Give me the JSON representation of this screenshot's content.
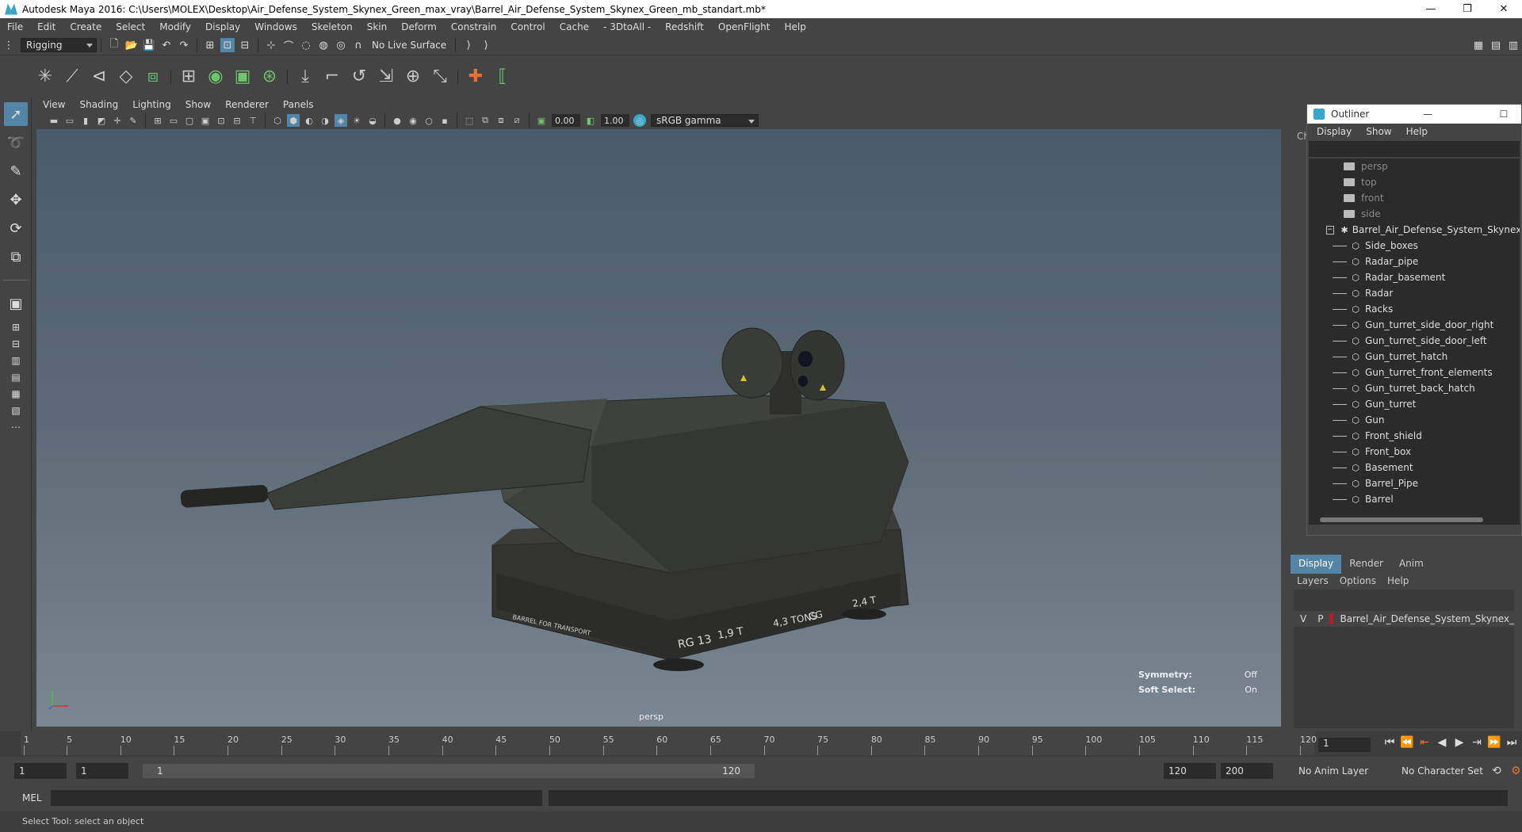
{
  "window": {
    "title": "Autodesk Maya 2016: C:\\Users\\MOLEX\\Desktop\\Air_Defense_System_Skynex_Green_max_vray\\Barrel_Air_Defense_System_Skynex_Green_mb_standart.mb*",
    "min": "—",
    "max": "❐",
    "close": "✕"
  },
  "menu": [
    "File",
    "Edit",
    "Create",
    "Select",
    "Modify",
    "Display",
    "Windows",
    "Skeleton",
    "Skin",
    "Deform",
    "Constrain",
    "Control",
    "Cache",
    "- 3DtoAll -",
    "Redshift",
    "OpenFlight",
    "Help"
  ],
  "status": {
    "mode": "Rigging",
    "live_surface": "No Live Surface"
  },
  "viewport": {
    "menus": [
      "View",
      "Shading",
      "Lighting",
      "Show",
      "Renderer",
      "Panels"
    ],
    "exposure": "0.00",
    "gamma": "1.00",
    "colorspace": "sRGB gamma",
    "camera_label": "persp",
    "hud": {
      "symmetry_label": "Symmetry:",
      "symmetry_value": "Off",
      "softsel_label": "Soft Select:",
      "softsel_value": "On"
    },
    "decals": {
      "rg": "RG 13",
      "weight1": "1,9 T",
      "weight2": "4,3 TONS",
      "cg": "CG",
      "weight3": "2,4 T",
      "transport": "BARREL FOR TRANSPORT"
    }
  },
  "outliner": {
    "title": "Outliner",
    "menus": [
      "Display",
      "Show",
      "Help"
    ],
    "cameras": [
      "persp",
      "top",
      "front",
      "side"
    ],
    "root": "Barrel_Air_Defense_System_Skynex_Green",
    "children": [
      "Side_boxes",
      "Radar_pipe",
      "Radar_basement",
      "Radar",
      "Racks",
      "Gun_turret_side_door_right",
      "Gun_turret_side_door_left",
      "Gun_turret_hatch",
      "Gun_turret_front_elements",
      "Gun_turret_back_hatch",
      "Gun_turret",
      "Gun",
      "Front_shield",
      "Front_box",
      "Basement",
      "Barrel_Pipe",
      "Barrel"
    ]
  },
  "channel_label": "Ch",
  "layers": {
    "tabs": [
      "Display",
      "Render",
      "Anim"
    ],
    "menus": [
      "Layers",
      "Options",
      "Help"
    ],
    "row": {
      "v": "V",
      "p": "P",
      "name": "Barrel_Air_Defense_System_Skynex_"
    }
  },
  "timeline": {
    "ticks": [
      "1",
      "5",
      "10",
      "15",
      "20",
      "25",
      "30",
      "35",
      "40",
      "45",
      "50",
      "55",
      "60",
      "65",
      "70",
      "75",
      "80",
      "85",
      "90",
      "95",
      "100",
      "105",
      "110",
      "115",
      "120"
    ],
    "current_frame": "1"
  },
  "range": {
    "start": "1",
    "playstart": "1",
    "slider_left": "1",
    "slider_right": "120",
    "playend": "120",
    "end": "200",
    "anim_layer": "No Anim Layer",
    "char_set": "No Character Set"
  },
  "mel": {
    "label": "MEL"
  },
  "help_line": "Select Tool: select an object"
}
